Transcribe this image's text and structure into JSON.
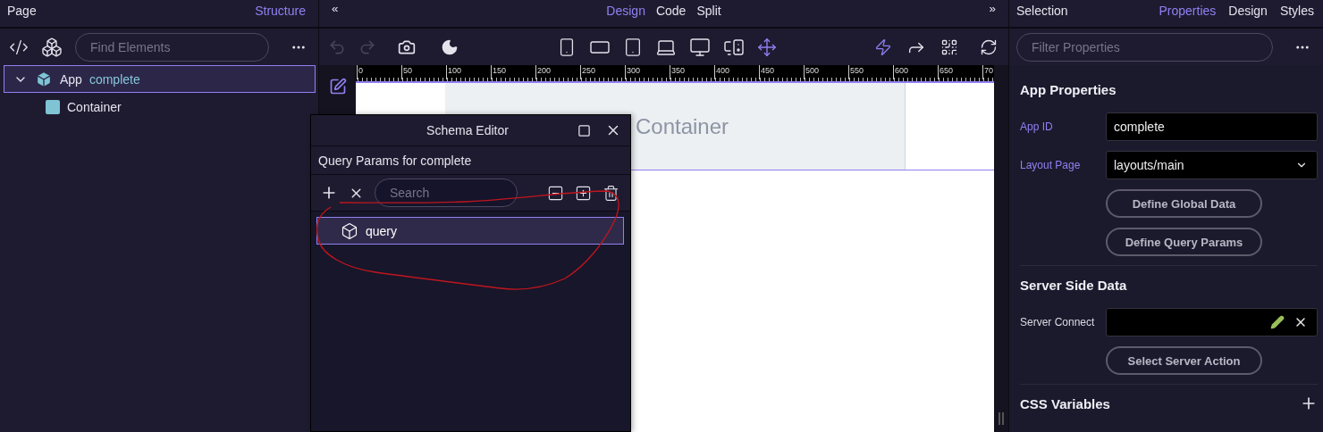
{
  "left_panel": {
    "title": "Page",
    "tab": "Structure",
    "search": {
      "placeholder": "Find Elements"
    },
    "tree": [
      {
        "label": "App",
        "id": "complete",
        "selected": true,
        "expanded": true,
        "children": [
          {
            "label": "Container",
            "selected": false
          }
        ]
      }
    ]
  },
  "center": {
    "collapse_left": "«",
    "collapse_right": "»",
    "view_tabs": [
      {
        "label": "Design",
        "selected": true
      },
      {
        "label": "Code",
        "selected": false
      },
      {
        "label": "Split",
        "selected": false
      }
    ],
    "history": {
      "undo_disabled": true,
      "redo_disabled": true
    },
    "ruler": [
      "0",
      "50",
      "100",
      "150",
      "200",
      "250",
      "300",
      "350",
      "400",
      "450",
      "500",
      "550",
      "600",
      "650",
      "70"
    ],
    "canvas": {
      "container_label": "Container"
    }
  },
  "schema_editor": {
    "title": "Schema Editor",
    "subtitle": "Query Params for complete",
    "search": {
      "placeholder": "Search"
    },
    "items": [
      {
        "label": "query",
        "selected": true
      }
    ]
  },
  "right_panel": {
    "title": "Selection",
    "tabs": [
      {
        "label": "Properties",
        "selected": true
      },
      {
        "label": "Design",
        "selected": false
      },
      {
        "label": "Styles",
        "selected": false
      }
    ],
    "filter": {
      "placeholder": "Filter Properties"
    },
    "sections": [
      {
        "title": "App Properties",
        "fields": [
          {
            "label": "App ID",
            "kind": "text",
            "highlighted": true,
            "value": "complete"
          },
          {
            "label": "Layout Page",
            "kind": "select",
            "highlighted": true,
            "value": "layouts/main"
          }
        ],
        "buttons": [
          "Define Global Data",
          "Define Query Params"
        ]
      },
      {
        "title": "Server Side Data",
        "fields": [
          {
            "label": "Server Connect",
            "kind": "picker",
            "highlighted": false
          }
        ],
        "buttons": [
          "Select Server Action"
        ]
      },
      {
        "title": "CSS Variables",
        "addable": true
      }
    ]
  }
}
